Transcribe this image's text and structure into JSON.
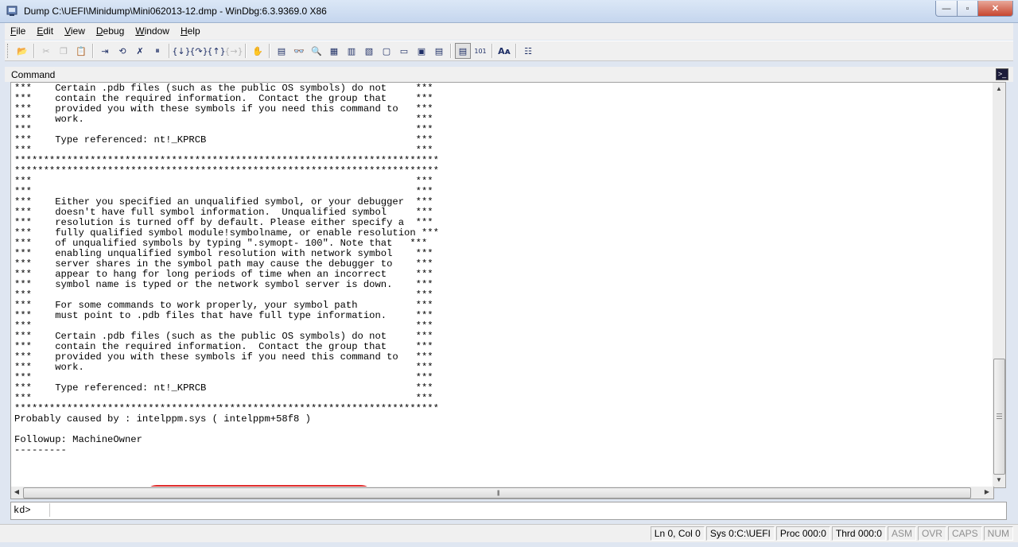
{
  "window": {
    "title": "Dump C:\\UEFI\\Minidump\\Mini062013-12.dmp - WinDbg:6.3.9369.0 X86",
    "app_icon": "windbg-app-icon",
    "buttons": {
      "minimize": "—",
      "maximize": "▫",
      "close": "✕"
    }
  },
  "menu": {
    "items": [
      {
        "key": "F",
        "rest": "ile"
      },
      {
        "key": "E",
        "rest": "dit"
      },
      {
        "key": "V",
        "rest": "iew"
      },
      {
        "key": "D",
        "rest": "ebug"
      },
      {
        "key": "W",
        "rest": "indow"
      },
      {
        "key": "H",
        "rest": "elp"
      }
    ]
  },
  "toolbar": {
    "icons": [
      {
        "name": "open-file-icon",
        "glyph": "📂",
        "enabled": true
      },
      {
        "name": "cut-icon",
        "glyph": "✂",
        "enabled": false
      },
      {
        "name": "copy-icon",
        "glyph": "❐",
        "enabled": false
      },
      {
        "name": "paste-icon",
        "glyph": "📋",
        "enabled": true
      },
      {
        "name": "go-icon",
        "glyph": "⇥",
        "enabled": true
      },
      {
        "name": "restart-icon",
        "glyph": "⟲",
        "enabled": true
      },
      {
        "name": "stop-debugging-icon",
        "glyph": "✗",
        "enabled": true
      },
      {
        "name": "break-icon",
        "glyph": "⏸",
        "enabled": true
      },
      {
        "name": "step-into-icon",
        "glyph": "{↓}",
        "enabled": true
      },
      {
        "name": "step-over-icon",
        "glyph": "{↷}",
        "enabled": true
      },
      {
        "name": "step-out-icon",
        "glyph": "{↑}",
        "enabled": true
      },
      {
        "name": "run-to-cursor-icon",
        "glyph": "{→}",
        "enabled": false
      },
      {
        "name": "insert-breakpoint-icon",
        "glyph": "✋",
        "enabled": true
      },
      {
        "name": "command-window-icon",
        "glyph": "▤",
        "enabled": true
      },
      {
        "name": "watch-window-icon",
        "glyph": "👓",
        "enabled": true
      },
      {
        "name": "locals-window-icon",
        "glyph": "🔍",
        "enabled": true
      },
      {
        "name": "registers-window-icon",
        "glyph": "▦",
        "enabled": true
      },
      {
        "name": "memory-window-icon",
        "glyph": "▥",
        "enabled": true
      },
      {
        "name": "call-stack-window-icon",
        "glyph": "▧",
        "enabled": true
      },
      {
        "name": "disassembly-window-icon",
        "glyph": "▢",
        "enabled": true
      },
      {
        "name": "scratch-pad-window-icon",
        "glyph": "▭",
        "enabled": true
      },
      {
        "name": "processes-threads-window-icon",
        "glyph": "▣",
        "enabled": true
      },
      {
        "name": "command-browser-window-icon",
        "glyph": "▤",
        "enabled": true
      },
      {
        "name": "source-mode-icon",
        "glyph": "▤",
        "enabled": true
      },
      {
        "name": "hex-mode-icon",
        "glyph": "101",
        "enabled": true
      },
      {
        "name": "font-icon",
        "glyph": "Aᴀ",
        "enabled": true
      },
      {
        "name": "options-icon",
        "glyph": "☷",
        "enabled": true
      }
    ]
  },
  "command_window": {
    "title": "Command",
    "lines": [
      "***    Certain .pdb files (such as the public OS symbols) do not     ***",
      "***    contain the required information.  Contact the group that     ***",
      "***    provided you with these symbols if you need this command to   ***",
      "***    work.                                                         ***",
      "***                                                                  ***",
      "***    Type referenced: nt!_KPRCB                                    ***",
      "***                                                                  ***",
      "*************************************************************************",
      "*************************************************************************",
      "***                                                                  ***",
      "***                                                                  ***",
      "***    Either you specified an unqualified symbol, or your debugger  ***",
      "***    doesn't have full symbol information.  Unqualified symbol     ***",
      "***    resolution is turned off by default. Please either specify a  ***",
      "***    fully qualified symbol module!symbolname, or enable resolution ***",
      "***    of unqualified symbols by typing \".symopt- 100\". Note that   ***",
      "***    enabling unqualified symbol resolution with network symbol    ***",
      "***    server shares in the symbol path may cause the debugger to    ***",
      "***    appear to hang for long periods of time when an incorrect     ***",
      "***    symbol name is typed or the network symbol server is down.    ***",
      "***                                                                  ***",
      "***    For some commands to work properly, your symbol path          ***",
      "***    must point to .pdb files that have full type information.     ***",
      "***                                                                  ***",
      "***    Certain .pdb files (such as the public OS symbols) do not     ***",
      "***    contain the required information.  Contact the group that     ***",
      "***    provided you with these symbols if you need this command to   ***",
      "***    work.                                                         ***",
      "***                                                                  ***",
      "***    Type referenced: nt!_KPRCB                                    ***",
      "***                                                                  ***",
      "*************************************************************************",
      "Probably caused by : intelppm.sys ( intelppm+58f8 )",
      "",
      "Followup: MachineOwner",
      "---------"
    ],
    "prompt": "kd>",
    "input_value": "",
    "scroll_icons": {
      "up": "▲",
      "down": "▼",
      "left": "◀",
      "right": "▶"
    }
  },
  "statusbar": {
    "cells": [
      {
        "text": "Ln 0, Col 0",
        "active": true
      },
      {
        "text": "Sys 0:C:\\UEFI",
        "active": true
      },
      {
        "text": "Proc 000:0",
        "active": true
      },
      {
        "text": "Thrd 000:0",
        "active": true
      },
      {
        "text": "ASM",
        "active": false
      },
      {
        "text": "OVR",
        "active": false
      },
      {
        "text": "CAPS",
        "active": false
      },
      {
        "text": "NUM",
        "active": false
      }
    ]
  },
  "colors": {
    "annotation_oval": "#e02d2d"
  }
}
